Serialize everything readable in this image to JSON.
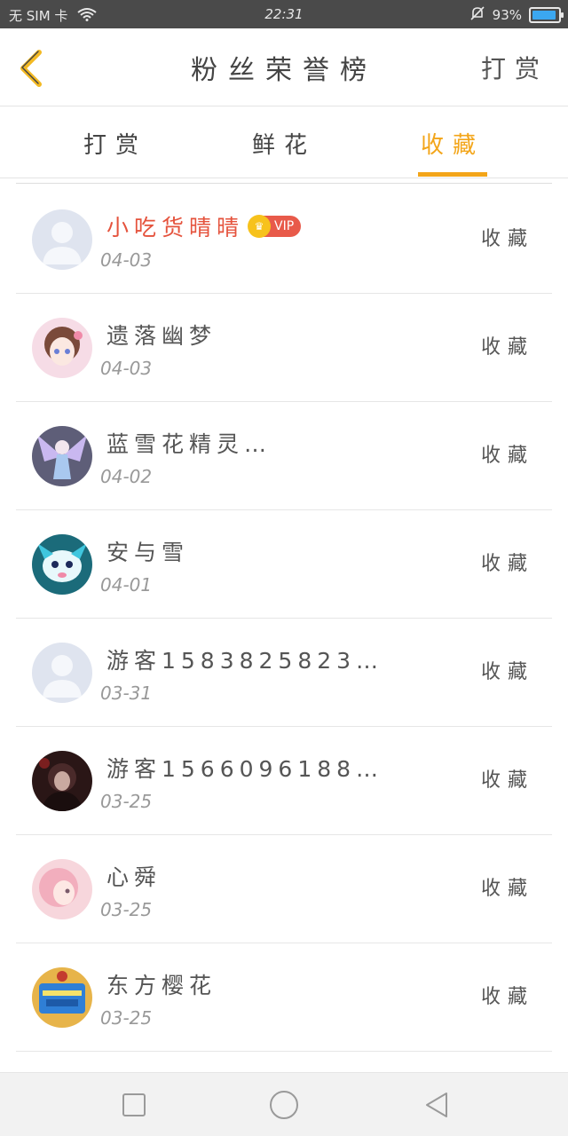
{
  "status_bar": {
    "left_items": [
      "无 SIM 卡"
    ],
    "time": "22:31",
    "battery_percent_label": "93%",
    "battery_level": 0.93
  },
  "header": {
    "title": "粉丝荣誉榜",
    "right_link": "打赏"
  },
  "tabs": [
    {
      "label": "打赏",
      "active": false
    },
    {
      "label": "鲜花",
      "active": false
    },
    {
      "label": "收藏",
      "active": true
    }
  ],
  "colors": {
    "accent": "#f3a519",
    "vip_name": "#e5533d",
    "vip_badge": "#e85a4a"
  },
  "list": [
    {
      "name": "小吃货晴晴",
      "date": "04-03",
      "action": "收藏",
      "vip": true,
      "vip_label": "VIP",
      "avatar": "default-avatar"
    },
    {
      "name": "遗落幽梦",
      "date": "04-03",
      "action": "收藏",
      "vip": false,
      "avatar": "anime-girl-avatar"
    },
    {
      "name": "蓝雪花精灵…",
      "date": "04-02",
      "action": "收藏",
      "vip": false,
      "avatar": "fairy-avatar"
    },
    {
      "name": "安与雪",
      "date": "04-01",
      "action": "收藏",
      "vip": false,
      "avatar": "cartoon-creature-avatar"
    },
    {
      "name": "游客1583825823…",
      "date": "03-31",
      "action": "收藏",
      "vip": false,
      "avatar": "default-avatar"
    },
    {
      "name": "游客1566096188…",
      "date": "03-25",
      "action": "收藏",
      "vip": false,
      "avatar": "dark-portrait-avatar"
    },
    {
      "name": "心舜",
      "date": "03-25",
      "action": "收藏",
      "vip": false,
      "avatar": "pink-hair-avatar"
    },
    {
      "name": "东方樱花",
      "date": "03-25",
      "action": "收藏",
      "vip": false,
      "avatar": "game-poster-avatar"
    }
  ],
  "nav": {
    "recent_icon": "square-icon",
    "home_icon": "circle-icon",
    "back_icon": "triangle-back-icon"
  }
}
